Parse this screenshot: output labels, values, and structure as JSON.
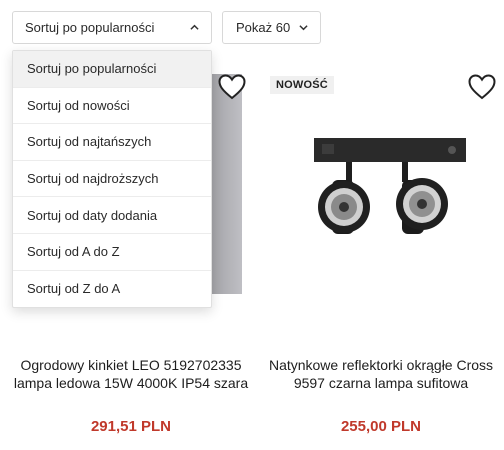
{
  "toolbar": {
    "sort_label": "Sortuj po popularności",
    "show_label": "Pokaż 60"
  },
  "sort_options": [
    "Sortuj po popularności",
    "Sortuj od nowości",
    "Sortuj od najtańszych",
    "Sortuj od najdroższych",
    "Sortuj od daty dodania",
    "Sortuj od A do Z",
    "Sortuj od Z do A"
  ],
  "products": [
    {
      "title": "Ogrodowy kinkiet LEO 5192702335 lampa ledowa 15W 4000K IP54 szara",
      "price": "291,51 PLN"
    },
    {
      "badge": "NOWOŚĆ",
      "title": "Natynkowe reflektorki okrągłe Cross 9597 czarna lampa sufitowa",
      "price": "255,00 PLN"
    }
  ],
  "colors": {
    "price": "#c0392b",
    "selected_bg": "#f1f1f1"
  }
}
